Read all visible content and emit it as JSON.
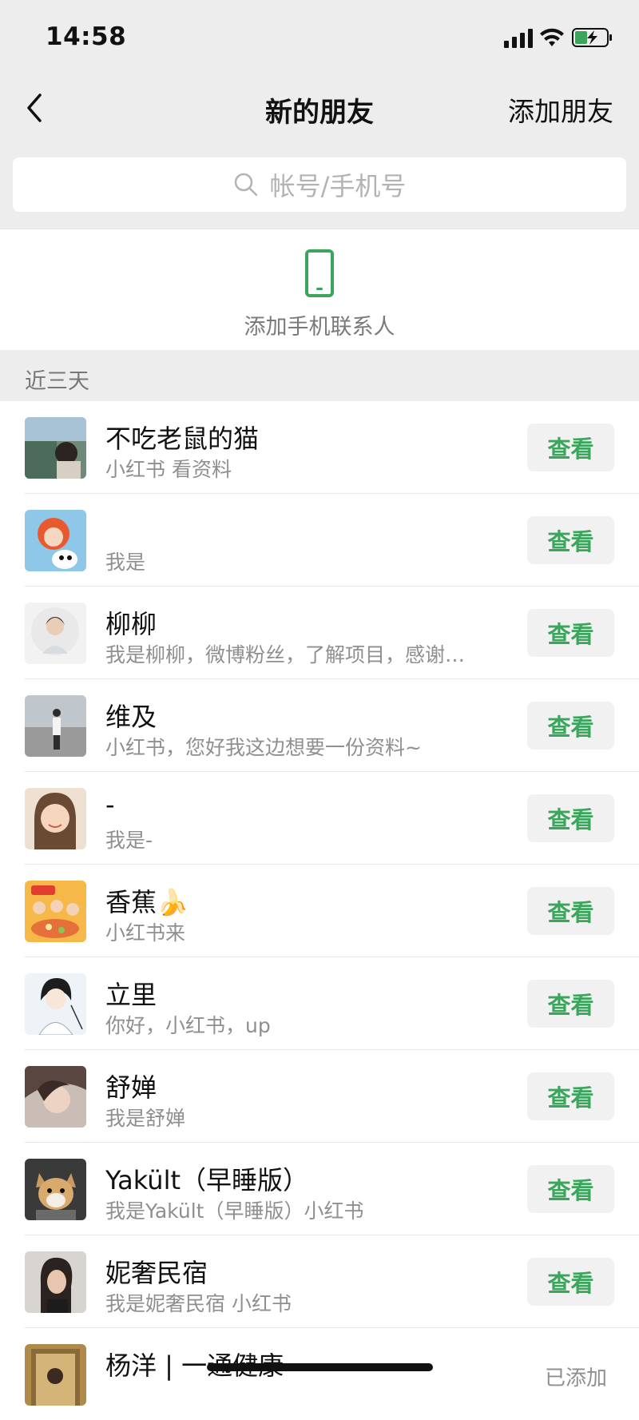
{
  "status_bar": {
    "time": "14:58",
    "battery_color": "#3ba55c"
  },
  "nav": {
    "title": "新的朋友",
    "add_label": "添加朋友"
  },
  "search": {
    "placeholder": "帐号/手机号"
  },
  "phone_contacts": {
    "label": "添加手机联系人",
    "icon_color": "#3ba55c"
  },
  "section": {
    "label": "近三天"
  },
  "colors": {
    "accent": "#3ba55c",
    "button_bg": "#f1f1f1"
  },
  "requests": [
    {
      "name": "不吃老鼠的猫",
      "message": "小红书 看资料",
      "action": "查看"
    },
    {
      "name": "",
      "message": "我是",
      "action": "查看"
    },
    {
      "name": "柳柳",
      "message": "我是柳柳，微博粉丝，了解项目，感谢…",
      "action": "查看"
    },
    {
      "name": "维及",
      "message": "小红书，您好我这边想要一份资料~",
      "action": "查看"
    },
    {
      "name": "-",
      "message": "我是-",
      "action": "查看"
    },
    {
      "name": "香蕉🍌",
      "message": "小红书来",
      "action": "查看"
    },
    {
      "name": "立里",
      "message": "你好，小红书，up",
      "action": "查看"
    },
    {
      "name": "舒婵",
      "message": "我是舒婵",
      "action": "查看"
    },
    {
      "name": "Yakült（早睡版）",
      "message": "我是Yakült（早睡版）小红书",
      "action": "查看"
    },
    {
      "name": "妮奢民宿",
      "message": "我是妮奢民宿 小红书",
      "action": "查看"
    },
    {
      "name": "杨洋 | 一通健康",
      "message": "",
      "status": "已添加"
    }
  ]
}
